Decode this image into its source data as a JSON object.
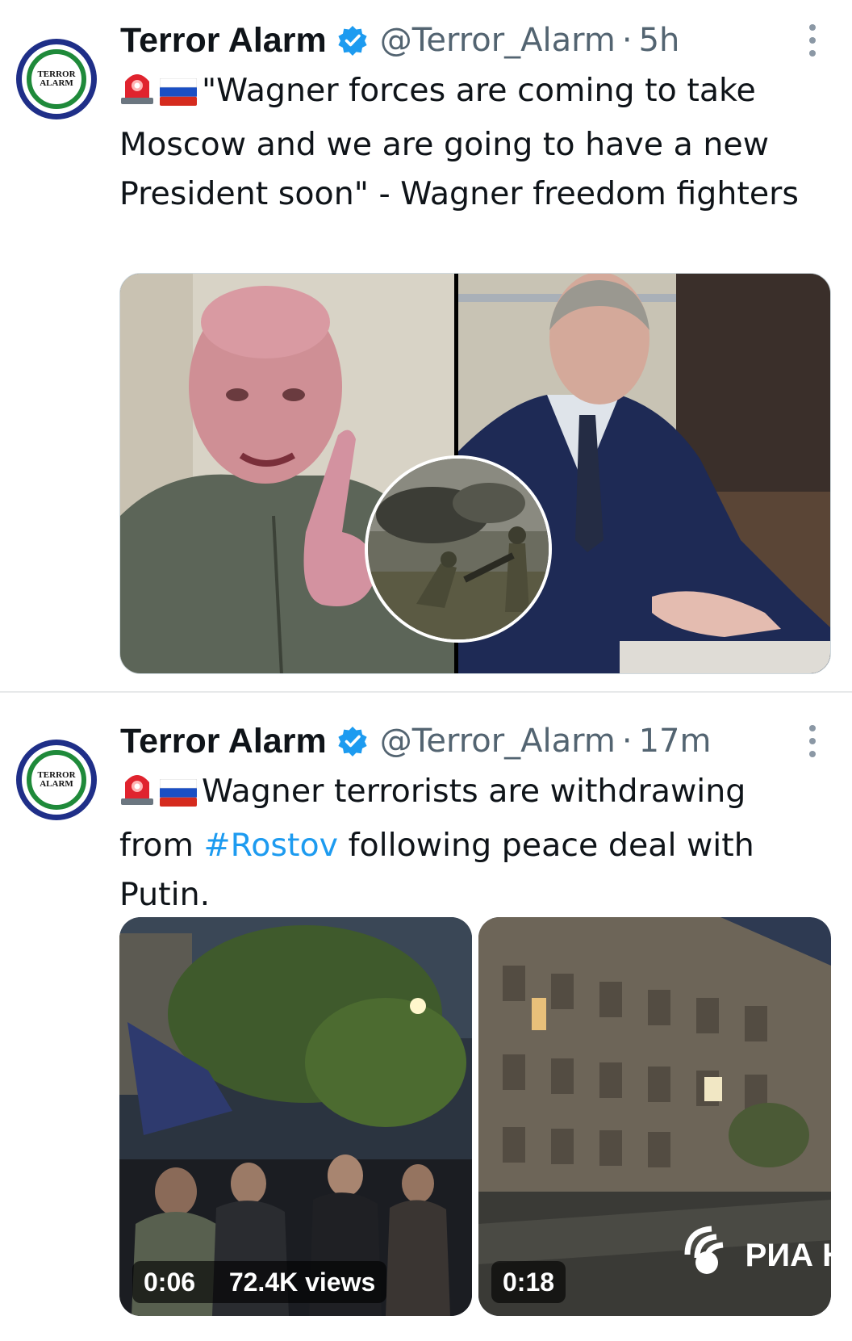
{
  "tweets": [
    {
      "author": {
        "name": "Terror Alarm",
        "handle": "@Terror_Alarm",
        "avatar_text": "TERROR\nALARM",
        "avatar_ring": "TERROR ALARM"
      },
      "time": "5h",
      "separator": "·",
      "text": "\"Wagner forces are coming to take Moscow and we are going to have a new President soon\" -  Wagner freedom fighters",
      "emojis": [
        "police-light-icon",
        "russia-flag-icon"
      ],
      "media": {
        "type": "photo-collage"
      }
    },
    {
      "author": {
        "name": "Terror Alarm",
        "handle": "@Terror_Alarm",
        "avatar_text": "TERROR\nALARM",
        "avatar_ring": "TERROR ALARM"
      },
      "time": "17m",
      "separator": "·",
      "text_before": "Wagner terrorists are withdrawing from ",
      "hashtag": "#Rostov",
      "text_after": " following peace deal with Putin.",
      "emojis": [
        "police-light-icon",
        "russia-flag-icon"
      ],
      "media": {
        "type": "videos",
        "videos": [
          {
            "duration": "0:06",
            "views": "72.4K views"
          },
          {
            "duration": "0:18",
            "watermark": "РИА Н"
          }
        ]
      }
    }
  ],
  "colors": {
    "verified": "#1d9bf0",
    "hashtag": "#1d9bf0",
    "secondary_text": "#536471"
  }
}
